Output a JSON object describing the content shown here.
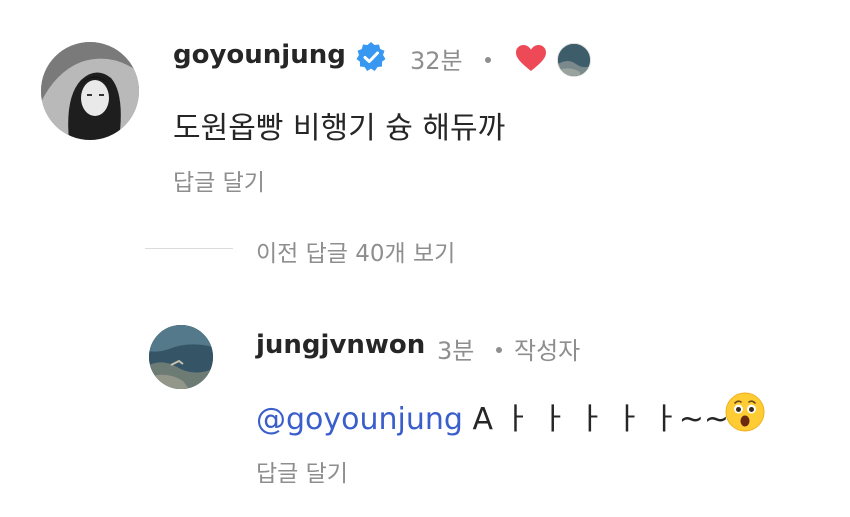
{
  "comment": {
    "username": "goyounjung",
    "time": "32분",
    "text": "도원옵빵 비행기 슝 해듀까",
    "reply_label": "답글 달기",
    "liked": true,
    "accent_heart": "#ed4956",
    "verified_color": "#3897f0"
  },
  "thread": {
    "view_previous_label": "이전 답글 40개 보기"
  },
  "reply": {
    "username": "jungjvnwon",
    "time": "3분",
    "author_badge": "작성자",
    "mention": "@goyounjung",
    "text": "A ㅏ ㅏ ㅏ ㅏ ㅏ~~",
    "emoji": "astonished-face",
    "reply_label": "답글 달기",
    "mention_color": "#3a5ecb"
  }
}
